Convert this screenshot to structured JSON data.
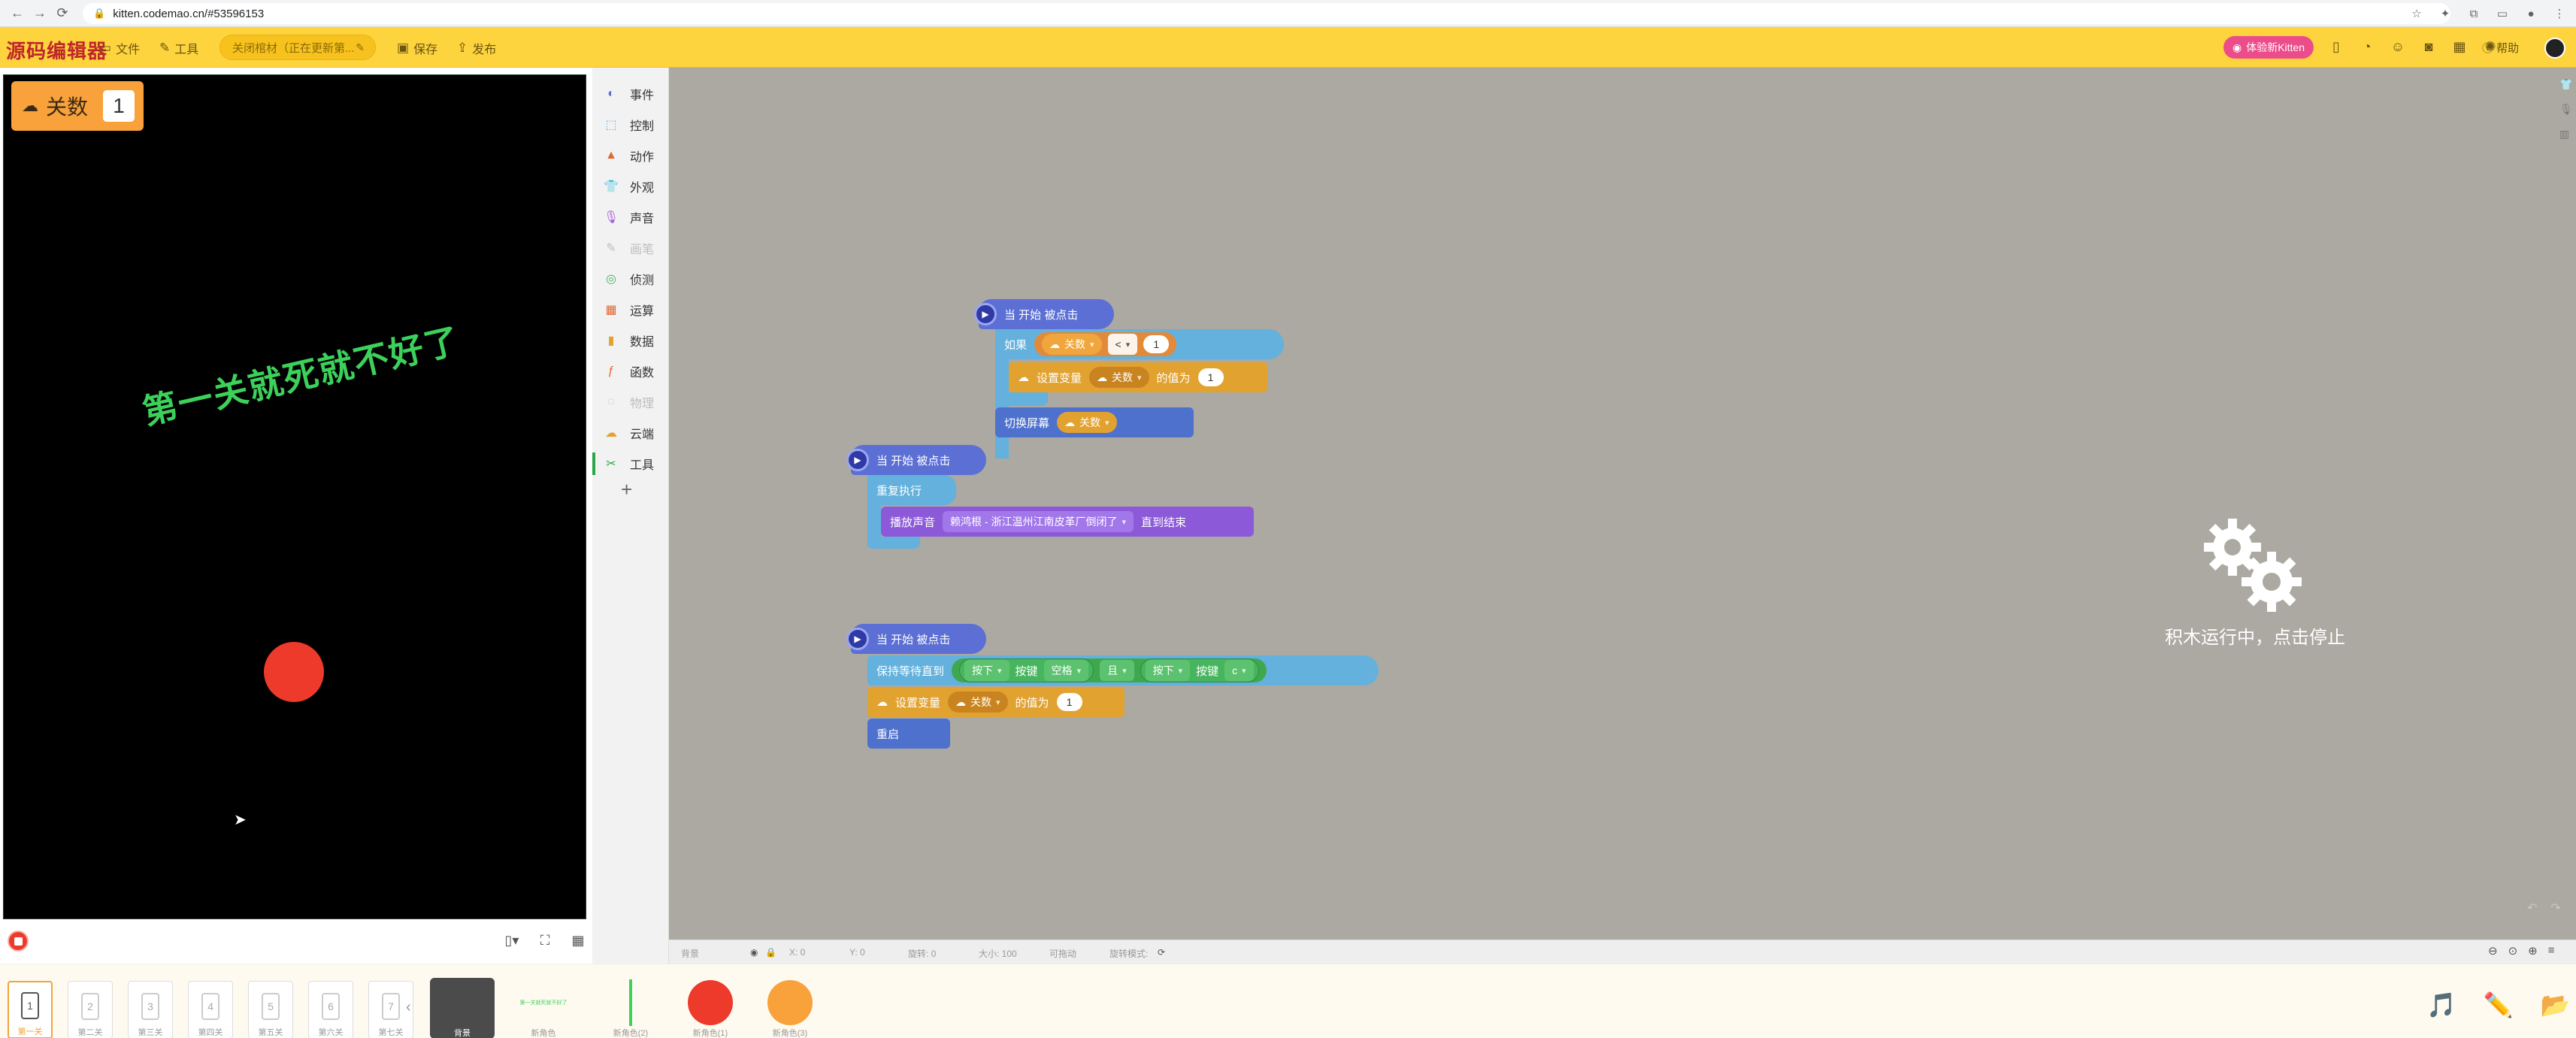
{
  "browser": {
    "url": "kitten.codemao.cn/#53596153"
  },
  "app": {
    "logo": "源码编辑器",
    "menu_file": "文件",
    "menu_tools": "工具",
    "project_title": "关闭棺材（正在更新第...",
    "save": "保存",
    "publish": "发布",
    "try_new": "体验新Kitten",
    "help": "帮助",
    "accent": "#fdd43e"
  },
  "stage": {
    "variable_name": "关数",
    "variable_value": "1",
    "text": "第一关就死就不好了",
    "ball_color": "#ee3a2b"
  },
  "categories": [
    {
      "label": "事件",
      "icon": "event-icon",
      "color": "#5b6fd4"
    },
    {
      "label": "控制",
      "icon": "control-icon",
      "color": "#63b1dc"
    },
    {
      "label": "动作",
      "icon": "motion-icon",
      "color": "#e2662f"
    },
    {
      "label": "外观",
      "icon": "look-icon",
      "color": "#8c5ad8"
    },
    {
      "label": "声音",
      "icon": "sound-icon",
      "color": "#a45ad8"
    },
    {
      "label": "画笔",
      "icon": "pen-icon",
      "color": "#bdbdbd"
    },
    {
      "label": "侦测",
      "icon": "sense-icon",
      "color": "#47b55e"
    },
    {
      "label": "运算",
      "icon": "operator-icon",
      "color": "#e2662f"
    },
    {
      "label": "数据",
      "icon": "data-icon",
      "color": "#e2a230"
    },
    {
      "label": "函数",
      "icon": "function-icon",
      "color": "#e2662f"
    },
    {
      "label": "物理",
      "icon": "physics-icon",
      "color": "#bdbdbd"
    },
    {
      "label": "云端",
      "icon": "cloud-icon",
      "color": "#e2a230"
    },
    {
      "label": "工具",
      "icon": "tool-icon",
      "color": "#2ba74a"
    }
  ],
  "blocks": {
    "when_start": "当 开始 被点击",
    "if": "如果",
    "var_guanshu": "关数",
    "op_lt": "<",
    "one": "1",
    "set_var": "设置变量",
    "set_value_to": "的值为",
    "switch_screen": "切换屏幕",
    "repeat_forever": "重复执行",
    "play_sound": "播放声音",
    "sound_name": "赖鸿根 - 浙江温州江南皮革厂倒闭了",
    "until_done": "直到结束",
    "wait_until": "保持等待直到",
    "pressed": "按下",
    "key": "按键",
    "space": "空格",
    "and": "且",
    "key_c": "c",
    "restart": "重启"
  },
  "workspace": {
    "running_text": "积木运行中，点击停止",
    "status_sprite": "背景",
    "status_x": "X: 0",
    "status_y": "Y: 0",
    "status_angle": "旋转: 0",
    "status_size": "大小: 100",
    "status_visible": "可拖动",
    "status_rotate": "旋转模式:"
  },
  "scenes": [
    "第一关",
    "第二关",
    "第三关",
    "第四关",
    "第五关",
    "第六关",
    "第七关"
  ],
  "sprites": [
    {
      "label": "背景"
    },
    {
      "label": "新角色"
    },
    {
      "label": "新角色(2)"
    },
    {
      "label": "新角色(1)"
    },
    {
      "label": "新角色(3)"
    }
  ]
}
